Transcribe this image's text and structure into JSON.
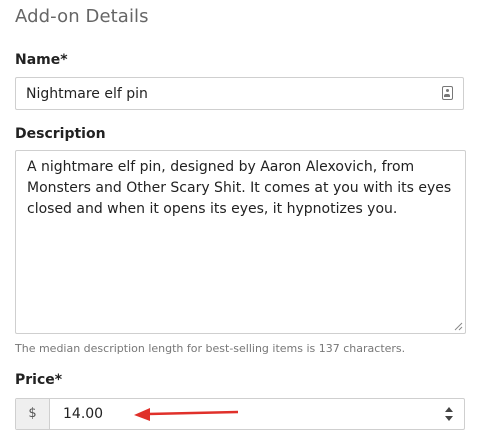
{
  "section": {
    "title": "Add-on Details"
  },
  "name_field": {
    "label": "Name*",
    "value": "Nightmare elf pin",
    "icon": "contact-card-icon"
  },
  "description_field": {
    "label": "Description",
    "value": "A nightmare elf pin, designed by Aaron Alexovich, from Monsters and Other Scary Shit. It comes at you with its eyes closed and when it opens its eyes, it hypnotizes you.",
    "help_text": "The median description length for best-selling items is 137 characters."
  },
  "price_field": {
    "label": "Price*",
    "currency_symbol": "$",
    "value": "14.00"
  },
  "annotation": {
    "arrow_color": "#e0302a",
    "icon": "red-arrow-left-icon"
  }
}
